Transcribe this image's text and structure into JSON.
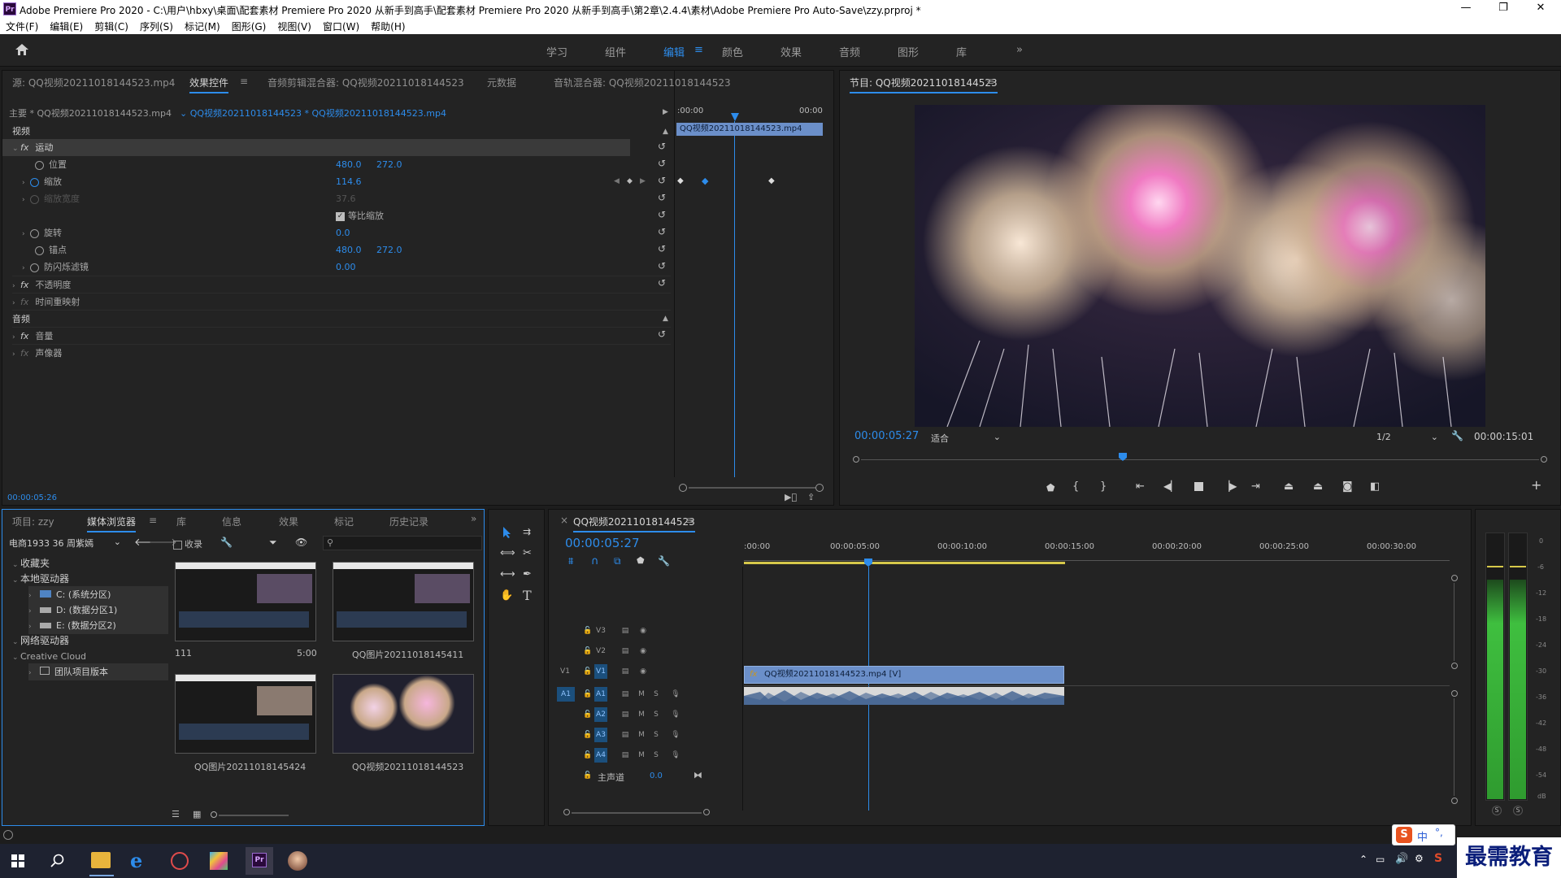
{
  "app": {
    "title": "Adobe Premiere Pro 2020 - C:\\用户\\hbxy\\桌面\\配套素材 Premiere Pro 2020 从新手到高手\\配套素材 Premiere Pro 2020 从新手到高手\\第2章\\2.4.4\\素材\\Adobe Premiere Pro Auto-Save\\zzy.prproj *",
    "logo": "Pr",
    "min": "—",
    "max": "❐",
    "close": "✕"
  },
  "menu": [
    "文件(F)",
    "编辑(E)",
    "剪辑(C)",
    "序列(S)",
    "标记(M)",
    "图形(G)",
    "视图(V)",
    "窗口(W)",
    "帮助(H)"
  ],
  "workspaces": {
    "items": [
      "学习",
      "组件",
      "编辑",
      "颜色",
      "效果",
      "音频",
      "图形",
      "库"
    ],
    "active": "编辑",
    "menu_glyph": "≡",
    "more": "»"
  },
  "source_panel": {
    "tabs": [
      "源: QQ视频20211018144523.mp4",
      "效果控件",
      "音频剪辑混合器: QQ视频20211018144523",
      "元数据",
      "音轨混合器: QQ视频20211018144523"
    ],
    "menu_glyph": "≡",
    "master_clip": "主要 * QQ视频20211018144523.mp4",
    "sequence_clip": "QQ视频20211018144523 * QQ视频20211018144523.mp4",
    "time_start": ":00:00",
    "time_end": "00:00",
    "clip_label": "QQ视频20211018144523.mp4",
    "timecode": "00:00:05:26",
    "section_video": "视频",
    "section_audio": "音频",
    "fx_glyph": "fx",
    "reset_glyph": "↺",
    "motion": "运动",
    "position": {
      "label": "位置",
      "x": "480.0",
      "y": "272.0"
    },
    "scale": {
      "label": "缩放",
      "value": "114.6"
    },
    "scale_width": {
      "label": "缩放宽度",
      "value": "37.6"
    },
    "uniform_scale": "等比缩放",
    "rotation": {
      "label": "旋转",
      "value": "0.0"
    },
    "anchor": {
      "label": "锚点",
      "x": "480.0",
      "y": "272.0"
    },
    "antiflicker": {
      "label": "防闪烁滤镜",
      "value": "0.00"
    },
    "opacity": "不透明度",
    "time_remap": "时间重映射",
    "volume": "音量",
    "panner": "声像器"
  },
  "program_monitor": {
    "title": "节目: QQ视频20211018144523",
    "menu_glyph": "≡",
    "timecode": "00:00:05:27",
    "fit": "适合",
    "resolution": "1/2",
    "duration": "00:00:15:01",
    "add_glyph": "+"
  },
  "project_panel": {
    "tabs": [
      "项目: zzy",
      "媒体浏览器",
      "库",
      "信息",
      "效果",
      "标记",
      "历史记录"
    ],
    "menu_glyph": "≡",
    "more": "»",
    "location": "电商1933 36 周紫嫣",
    "ingest": "收录",
    "tree": {
      "favorites": "收藏夹",
      "local": "本地驱动器",
      "drive_c": "C: (系统分区)",
      "drive_d": "D: (数据分区1)",
      "drive_e": "E: (数据分区2)",
      "network": "网络驱动器",
      "cc": "Creative Cloud",
      "team": "团队项目版本"
    },
    "items": [
      {
        "name": "111",
        "duration": "5:00"
      },
      {
        "name": "QQ图片20211018145411"
      },
      {
        "name": "QQ图片20211018145424"
      },
      {
        "name": "QQ视频20211018144523"
      }
    ]
  },
  "timeline": {
    "close_glyph": "×",
    "title": "QQ视频20211018144523",
    "menu_glyph": "≡",
    "timecode": "00:00:05:27",
    "ruler": [
      ":00:00",
      "00:00:05:00",
      "00:00:10:00",
      "00:00:15:00",
      "00:00:20:00",
      "00:00:25:00",
      "00:00:30:00"
    ],
    "tracks": {
      "V3": "V3",
      "V2": "V2",
      "V1": "V1",
      "A1": "A1",
      "A2": "A2",
      "A3": "A3",
      "A4": "A4",
      "src_v1": "V1",
      "src_a1": "A1",
      "mute": "M",
      "solo": "S"
    },
    "clip_label": "QQ视频20211018144523.mp4 [V]",
    "master": "主声道",
    "master_value": "0.0"
  },
  "meters": {
    "labels": [
      "0",
      "-6",
      "-12",
      "-18",
      "-24",
      "-30",
      "-36",
      "-42",
      "-48",
      "-54",
      "dB"
    ],
    "solo": "S"
  },
  "tray": {
    "ime": "中",
    "watermark": "最需教育"
  },
  "colors": {
    "accent": "#2d8ceb",
    "panel_bg": "#232323",
    "clip_video": "#6b8fc9",
    "clip_audio": "#3e5f8f",
    "work_area": "#d6c84a"
  }
}
